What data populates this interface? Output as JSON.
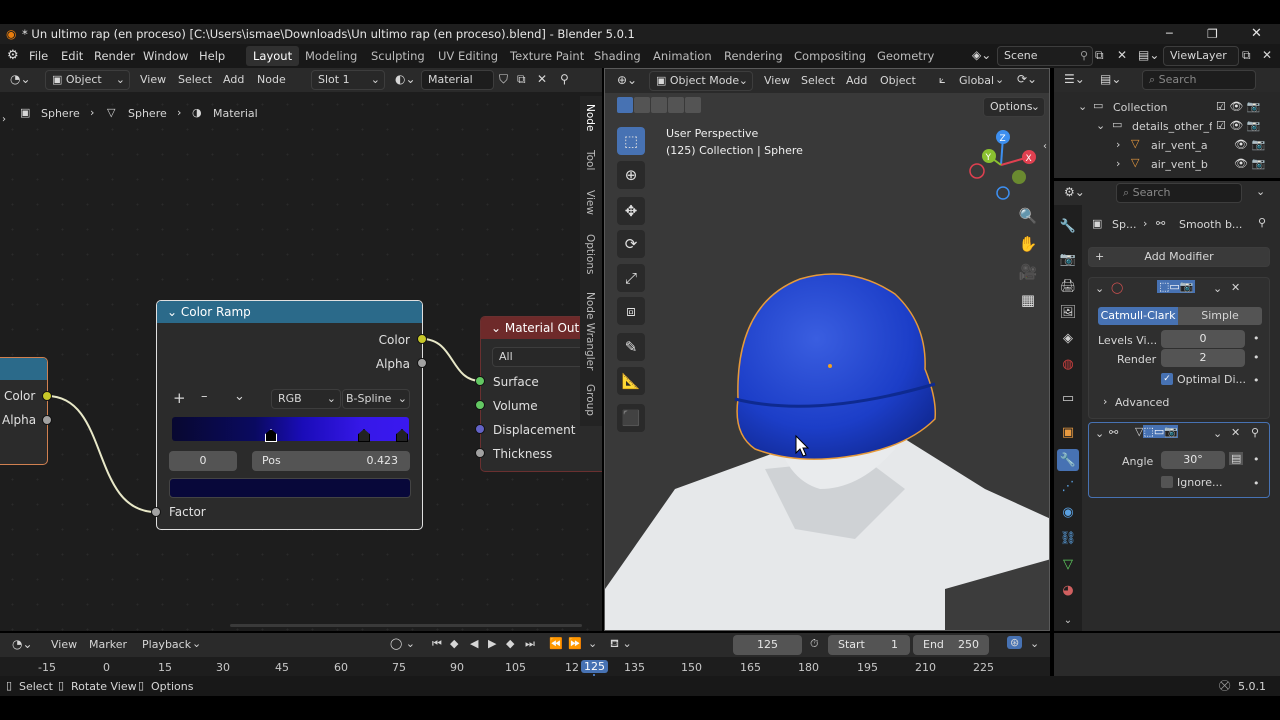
{
  "window": {
    "title": "* Un ultimo rap (en proceso) [C:\\Users\\ismae\\Downloads\\Un ultimo rap (en proceso).blend] - Blender 5.0.1",
    "min": "─",
    "max": "❐",
    "close": "✕"
  },
  "menu": {
    "items": [
      "File",
      "Edit",
      "Render",
      "Window",
      "Help"
    ],
    "workspaces": [
      "Layout",
      "Modeling",
      "Sculpting",
      "UV Editing",
      "Texture Paint",
      "Shading",
      "Animation",
      "Rendering",
      "Compositing",
      "Geometry Nodes"
    ],
    "scene": "Scene",
    "view_layer": "ViewLayer"
  },
  "node_editor": {
    "object_mode": "Object",
    "menus": [
      "View",
      "Select",
      "Add",
      "Node"
    ],
    "slot": "Slot 1",
    "material": "Material",
    "breadcrumb": [
      "Sphere",
      "Sphere",
      "Material"
    ],
    "side_tabs": [
      "Node",
      "Tool",
      "View",
      "Options",
      "Node Wrangler",
      "Group"
    ],
    "partial_node": {
      "outputs": [
        "Color",
        "Alpha"
      ]
    },
    "color_ramp": {
      "title": "Color Ramp",
      "outputs": [
        "Color",
        "Alpha"
      ],
      "add": "+",
      "remove": "–",
      "menu": "⌄",
      "color_mode": "RGB",
      "interpolation": "B-Spline",
      "active_index": "0",
      "pos_label": "Pos",
      "pos_value": "0.423",
      "input": "Factor"
    },
    "material_output": {
      "title": "Material Outp",
      "target": "All",
      "inputs": [
        "Surface",
        "Volume",
        "Displacement",
        "Thickness"
      ]
    }
  },
  "viewport": {
    "mode": "Object Mode",
    "menus": [
      "View",
      "Select",
      "Add",
      "Object"
    ],
    "transform": "Global",
    "options": "Options",
    "perspective": "User Perspective",
    "collection_info": "(125) Collection | Sphere",
    "gizmo": {
      "x": "X",
      "y": "Y",
      "z": "Z"
    }
  },
  "outliner": {
    "search_placeholder": "Search",
    "items": [
      "Collection",
      "details_other_flo",
      "air_vent_a",
      "air_vent_b"
    ]
  },
  "properties": {
    "search_placeholder": "Search",
    "breadcrumb_obj": "Sp...",
    "breadcrumb_mod": "Smooth b...",
    "add_modifier": "Add Modifier",
    "subsurf": {
      "mode_a": "Catmull-Clark",
      "mode_b": "Simple",
      "levels_label": "Levels Vi...",
      "levels_value": "0",
      "render_label": "Render",
      "render_value": "2",
      "optimal": "Optimal Di...",
      "advanced": "Advanced"
    },
    "smooth": {
      "angle_label": "Angle",
      "angle_value": "30°",
      "ignore": "Ignore..."
    }
  },
  "timeline": {
    "menus": [
      "View",
      "Marker",
      "Playback"
    ],
    "current_frame": "125",
    "start_label": "Start",
    "start": "1",
    "end_label": "End",
    "end": "250",
    "ticks": [
      "-15",
      "0",
      "15",
      "30",
      "45",
      "60",
      "75",
      "90",
      "105",
      "12",
      "125",
      "135",
      "150",
      "165",
      "180",
      "195",
      "210",
      "225"
    ]
  },
  "statusbar": {
    "select": "Select",
    "rotate": "Rotate View",
    "options": "Options",
    "version": "5.0.1"
  },
  "colors": {
    "accent_blue": "#4772b3",
    "node_header_teal": "#2b6a8a",
    "node_header_red": "#6e2a2a",
    "socket_yellow": "#c7c729",
    "socket_grey": "#a1a1a1",
    "socket_green": "#63c763",
    "socket_purple": "#6363c7"
  }
}
